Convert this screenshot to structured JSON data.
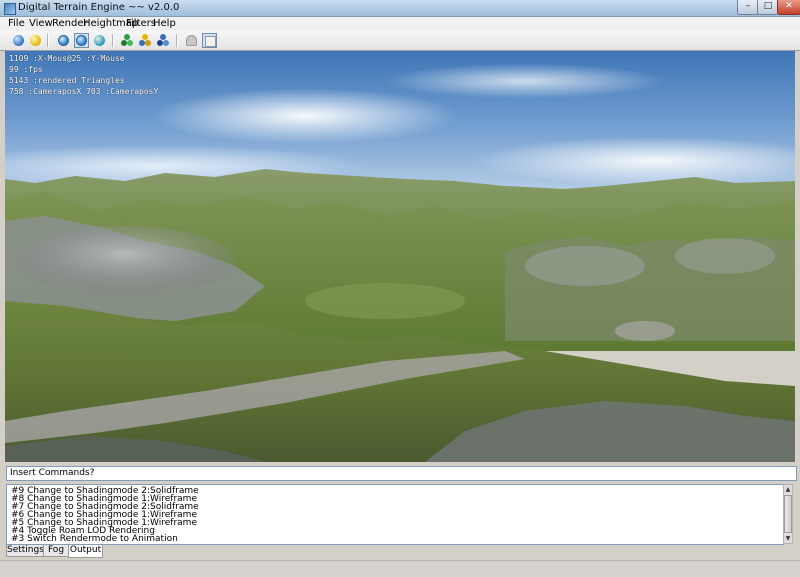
{
  "window": {
    "title": "Digital Terrain Engine ~~ v2.0.0"
  },
  "title_buttons": {
    "minimize": "–",
    "maximize": "□",
    "close": "✕"
  },
  "menu": [
    "File",
    "View",
    "Render",
    "Heightmap",
    "Filters",
    "Help"
  ],
  "toolbar": {
    "icons": [
      "blue-sphere",
      "yellow-sphere",
      "globe",
      "globe-selected",
      "globe-alt",
      "green-cluster",
      "yellow-cluster",
      "blue-cluster",
      "disabled-tool",
      "frame-tool"
    ]
  },
  "hud": {
    "line1": "1109 :X-Mous@25 :Y-Mouse",
    "line2": "99 :fps",
    "line3": "5143 :rendered Triangles",
    "line4": "758 :CameraposX 703 :CameraposY"
  },
  "command": {
    "value": "Insert Commands?"
  },
  "log": [
    "#9 Change to Shadingmode 2:Solidframe",
    "#8 Change to Shadingmode 1:Wireframe",
    "#7 Change to Shadingmode 2:Solidframe",
    "#6 Change to Shadingmode 1:Wireframe",
    "#5 Change to Shadingmode 1:Wireframe",
    "#4 Toggle Roam LOD Rendering",
    "#3 Switch Rendermode to Animation"
  ],
  "tabs": {
    "settings": "Settings",
    "fog": "Fog",
    "output": "Output"
  },
  "scroll": {
    "up": "▲",
    "down": "▼"
  }
}
